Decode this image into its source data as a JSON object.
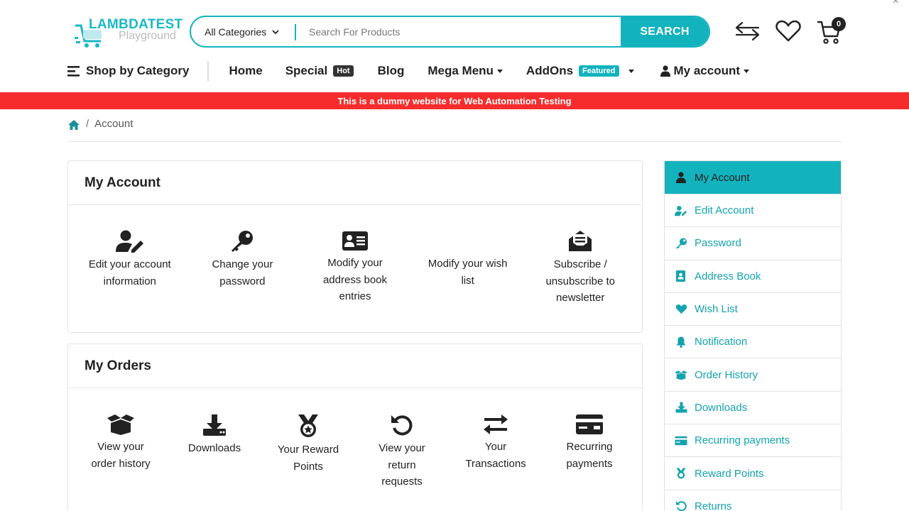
{
  "logo": {
    "title": "LAMBDATEST",
    "subtitle": "Playground"
  },
  "search": {
    "category": "All Categories",
    "placeholder": "Search For Products",
    "button_label": "SEARCH"
  },
  "cart": {
    "count": "0"
  },
  "nav": {
    "shop_by_category": "Shop by Category",
    "home": "Home",
    "special": "Special",
    "special_badge": "Hot",
    "blog": "Blog",
    "mega_menu": "Mega Menu",
    "addons": "AddOns",
    "addons_badge": "Featured",
    "my_account": "My account"
  },
  "banner": "This is a dummy website for Web Automation Testing",
  "breadcrumb": {
    "current": "Account"
  },
  "account_card": {
    "title": "My Account",
    "tiles": [
      {
        "label": "Edit your account information",
        "icon": "user-edit-icon"
      },
      {
        "label": "Change your password",
        "icon": "key-icon"
      },
      {
        "label": "Modify your address book entries",
        "icon": "address-card-icon"
      },
      {
        "label": "Modify your wish list",
        "icon": ""
      },
      {
        "label": "Subscribe / unsubscribe to newsletter",
        "icon": "envelope-open-icon"
      }
    ]
  },
  "orders_card": {
    "title": "My Orders",
    "tiles": [
      {
        "label": "View your order history",
        "icon": "box-open-icon"
      },
      {
        "label": "Downloads",
        "icon": "download-icon"
      },
      {
        "label": "Your Reward Points",
        "icon": "medal-icon"
      },
      {
        "label": "View your return requests",
        "icon": "undo-icon"
      },
      {
        "label": "Your Transactions",
        "icon": "exchange-icon"
      },
      {
        "label": "Recurring payments",
        "icon": "credit-card-icon"
      }
    ]
  },
  "sidebar": {
    "items": [
      {
        "label": "My Account",
        "icon": "user-icon"
      },
      {
        "label": "Edit Account",
        "icon": "user-edit-icon"
      },
      {
        "label": "Password",
        "icon": "key-icon"
      },
      {
        "label": "Address Book",
        "icon": "address-book-icon"
      },
      {
        "label": "Wish List",
        "icon": "heart-icon"
      },
      {
        "label": "Notification",
        "icon": "bell-icon"
      },
      {
        "label": "Order History",
        "icon": "box-open-icon"
      },
      {
        "label": "Downloads",
        "icon": "download-icon"
      },
      {
        "label": "Recurring payments",
        "icon": "credit-card-icon"
      },
      {
        "label": "Reward Points",
        "icon": "medal-icon"
      },
      {
        "label": "Returns",
        "icon": "undo-icon"
      }
    ]
  },
  "colors": {
    "accent": "#13b3bd",
    "banner": "#f62c2c",
    "link": "#13a3ad"
  }
}
